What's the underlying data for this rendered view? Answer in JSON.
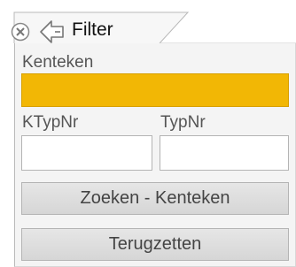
{
  "tab": {
    "title": "Filter",
    "close_icon": "close-circle-icon",
    "back_icon": "back-arrow-icon"
  },
  "form": {
    "kenteken_label": "Kenteken",
    "kenteken_value": "",
    "ktypnr_label": "KTypNr",
    "ktypnr_value": "",
    "typnr_label": "TypNr",
    "typnr_value": ""
  },
  "buttons": {
    "search_label": "Zoeken - Kenteken",
    "reset_label": "Terugzetten"
  },
  "colors": {
    "kenteken_field": "#f2b705",
    "panel_bg": "#f4f4f4",
    "button_bg": "#dcdcdc"
  }
}
